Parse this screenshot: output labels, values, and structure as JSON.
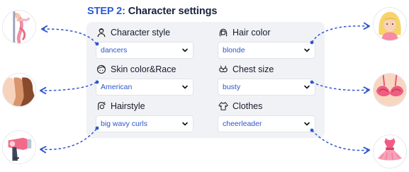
{
  "header": {
    "step": "STEP 2:",
    "title": "Character settings"
  },
  "fields": {
    "character_style": {
      "label": "Character style",
      "value": "dancers",
      "icon": "character-icon"
    },
    "hair_color": {
      "label": "Hair color",
      "value": "blonde",
      "icon": "hair-icon"
    },
    "skin_race": {
      "label": "Skin color&Race",
      "value": "American",
      "icon": "skin-icon"
    },
    "chest_size": {
      "label": "Chest size",
      "value": "busty",
      "icon": "chest-icon"
    },
    "hairstyle": {
      "label": "Hairstyle",
      "value": "big wavy curls",
      "icon": "hairstyle-icon"
    },
    "clothes": {
      "label": "Clothes",
      "value": "cheerleader",
      "icon": "clothes-icon"
    }
  },
  "colors": {
    "accent": "#2d5bd6",
    "value_text": "#2d55c9",
    "panel_bg": "#f1f2f5",
    "connector": "#2f56d0"
  },
  "illustrations": [
    "dancer-pole-icon",
    "skin-tones-icon",
    "hair-dryer-icon",
    "blonde-woman-icon",
    "bra-icon",
    "tutu-dress-icon"
  ]
}
